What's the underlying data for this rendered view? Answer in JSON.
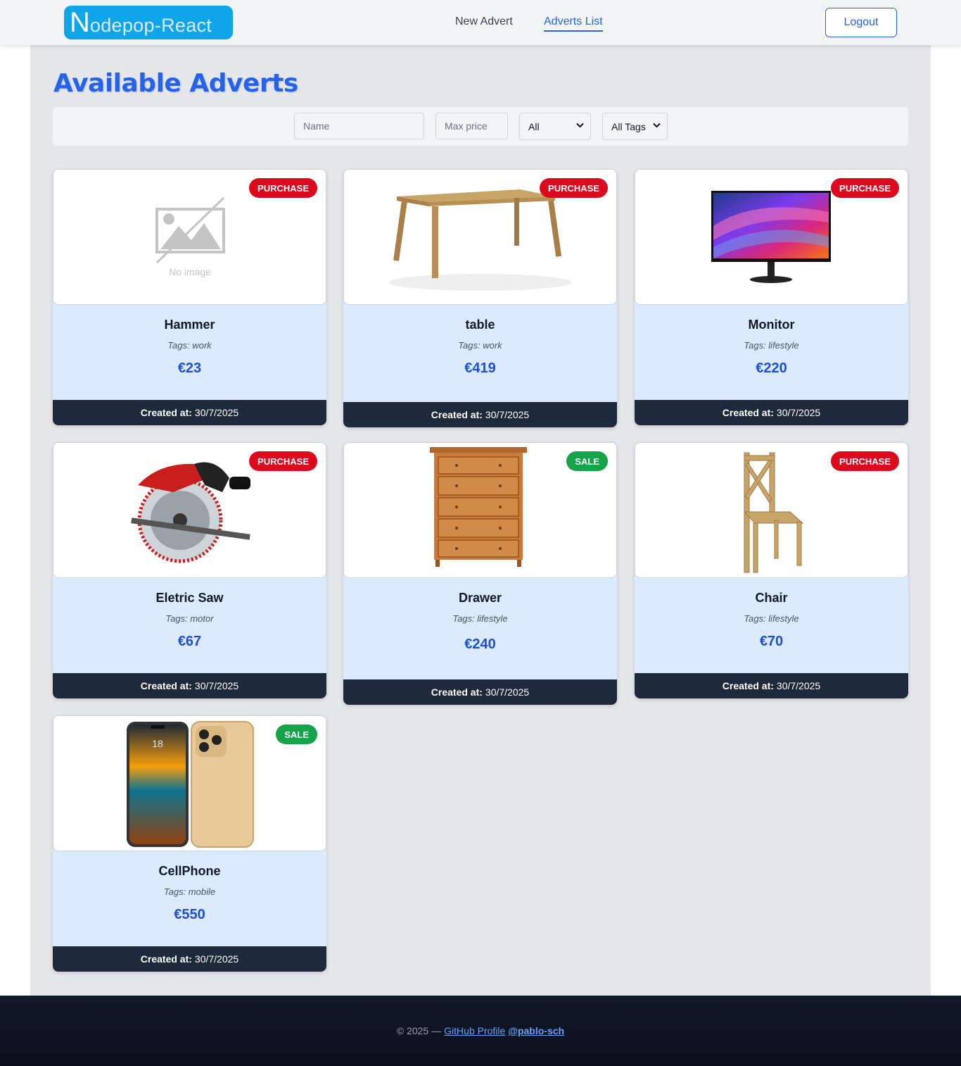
{
  "header": {
    "logo_first": "N",
    "logo_rest": "odepop-React",
    "nav_new": "New Advert",
    "nav_list": "Adverts List",
    "logout": "Logout"
  },
  "page": {
    "title": "Available Adverts"
  },
  "filters": {
    "name_placeholder": "Name",
    "price_placeholder": "Max price",
    "type_value": "All",
    "tags_value": "All Tags"
  },
  "cards": [
    {
      "name": "Hammer",
      "tags": "Tags: work",
      "price": "€23",
      "badge": "PURCHASE",
      "created_label": "Created at:",
      "created": "30/7/2025",
      "image": "no-image",
      "no_image_text": "No image"
    },
    {
      "name": "table",
      "tags": "Tags: work",
      "price": "€419",
      "badge": "PURCHASE",
      "created_label": "Created at:",
      "created": "30/7/2025",
      "image": "table"
    },
    {
      "name": "Monitor",
      "tags": "Tags: lifestyle",
      "price": "€220",
      "badge": "PURCHASE",
      "created_label": "Created at:",
      "created": "30/7/2025",
      "image": "monitor"
    },
    {
      "name": "Eletric Saw",
      "tags": "Tags: motor",
      "price": "€67",
      "badge": "PURCHASE",
      "created_label": "Created at:",
      "created": "30/7/2025",
      "image": "saw"
    },
    {
      "name": "Drawer",
      "tags": "Tags: lifestyle",
      "price": "€240",
      "badge": "SALE",
      "created_label": "Created at:",
      "created": "30/7/2025",
      "image": "drawer"
    },
    {
      "name": "Chair",
      "tags": "Tags: lifestyle",
      "price": "€70",
      "badge": "PURCHASE",
      "created_label": "Created at:",
      "created": "30/7/2025",
      "image": "chair"
    },
    {
      "name": "CellPhone",
      "tags": "Tags: mobile",
      "price": "€550",
      "badge": "SALE",
      "created_label": "Created at:",
      "created": "30/7/2025",
      "image": "cellphone",
      "phone_time": "18"
    }
  ],
  "footer": {
    "text": "© 2025 —",
    "github": "GitHub Profile",
    "handle": "@pablo-sch"
  },
  "colors": {
    "accent": "#2563eb",
    "purchase": "#dc0a1e",
    "sale": "#16a34a",
    "card_body": "#dbeafe",
    "card_footer": "#1e293b"
  }
}
